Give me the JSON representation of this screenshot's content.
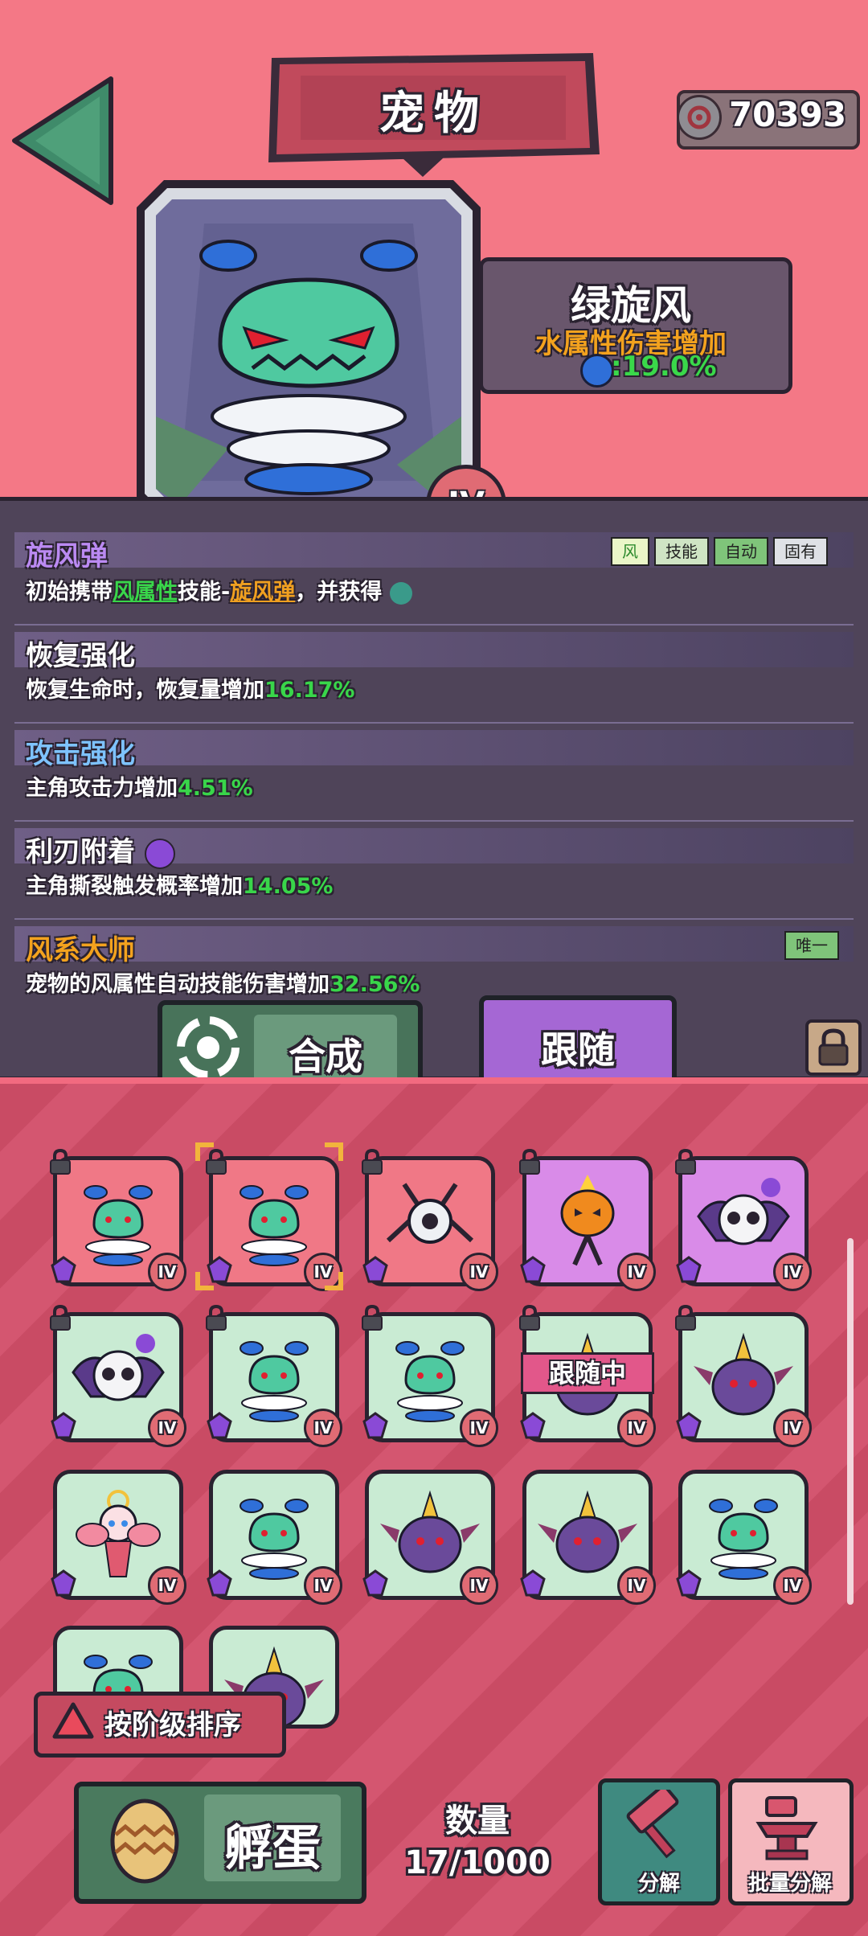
{
  "header": {
    "title": "宠物",
    "currency_value": "70393",
    "icons": [
      "back-arrow-icon",
      "gear-coin-icon"
    ]
  },
  "pet": {
    "name": "绿旋风",
    "attribute": "水属性伤害增加",
    "attribute_value": ":19.0%",
    "rank": "IV"
  },
  "skills": [
    {
      "name": "旋风弹",
      "desc_pre": "初始携带",
      "desc_hl1": "风属性",
      "desc_mid": "技能-",
      "desc_hl2": "旋风弹",
      "desc_post": "，并获得",
      "tags": [
        "风",
        "技能",
        "自动",
        "固有"
      ]
    },
    {
      "name": "恢复强化",
      "desc_pre": "恢复生命时，恢复量增加",
      "desc_val": "16.17%"
    },
    {
      "name": "攻击强化",
      "desc_pre": "主角攻击力增加",
      "desc_val": "4.51%"
    },
    {
      "name": "利刃附着",
      "desc_pre": "主角撕裂触发概率增加",
      "desc_val": "14.05%"
    },
    {
      "name": "风系大师",
      "desc_pre": "宠物的风属性自动技能伤害增加",
      "desc_val": "32.56%",
      "tag": "唯一"
    }
  ],
  "actions": {
    "compose": "合成",
    "follow": "跟随"
  },
  "grid": {
    "follow_banner": "跟随中",
    "rank_label": "IV",
    "cells": [
      {
        "type": "whirlwind",
        "bg": "red",
        "locked": true,
        "selected": false
      },
      {
        "type": "whirlwind",
        "bg": "red",
        "locked": true,
        "selected": true
      },
      {
        "type": "drone",
        "bg": "red",
        "locked": true,
        "selected": false
      },
      {
        "type": "pumpkin",
        "bg": "purple",
        "locked": true,
        "selected": false
      },
      {
        "type": "skull",
        "bg": "purple",
        "locked": true,
        "selected": false
      },
      {
        "type": "skull",
        "bg": "green",
        "locked": true,
        "selected": false
      },
      {
        "type": "whirlwind",
        "bg": "green",
        "locked": true,
        "selected": false
      },
      {
        "type": "whirlwind",
        "bg": "green",
        "locked": true,
        "selected": false
      },
      {
        "type": "horned",
        "bg": "green",
        "locked": true,
        "selected": false
      },
      {
        "type": "horned",
        "bg": "green",
        "locked": true,
        "selected": false
      },
      {
        "type": "fairy",
        "bg": "green",
        "locked": false,
        "selected": false
      },
      {
        "type": "whirlwind",
        "bg": "green",
        "locked": false,
        "selected": false
      },
      {
        "type": "horned",
        "bg": "green",
        "locked": false,
        "selected": false
      },
      {
        "type": "horned",
        "bg": "green",
        "locked": false,
        "selected": false
      },
      {
        "type": "whirlwind",
        "bg": "green",
        "locked": false,
        "selected": false
      },
      {
        "type": "whirlwind",
        "bg": "green",
        "locked": false,
        "selected": false
      },
      {
        "type": "horned",
        "bg": "green",
        "locked": false,
        "selected": false
      }
    ]
  },
  "sort": {
    "label": "按阶级排序"
  },
  "footer": {
    "hatch": "孵蛋",
    "count_title": "数量",
    "count_value": "17/1000",
    "decompose": "分解",
    "batch_decompose": "批量分解"
  }
}
